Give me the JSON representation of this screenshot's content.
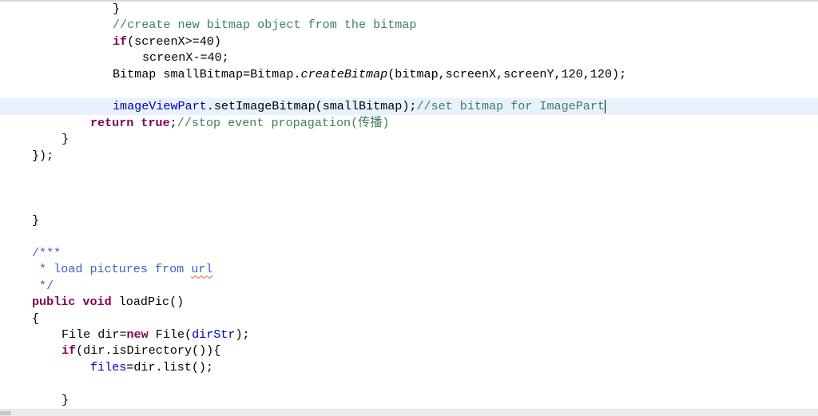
{
  "editor": {
    "current_line": 6,
    "lines": [
      [
        [
          "p",
          "}"
        ]
      ],
      [
        [
          "c",
          "//create new bitmap object from the bitmap"
        ]
      ],
      [
        [
          "k",
          "if"
        ],
        [
          "p",
          "(screenX>=40)"
        ]
      ],
      [
        [
          "p",
          "screenX-=40;"
        ]
      ],
      [
        [
          "p",
          "Bitmap smallBitmap=Bitmap."
        ],
        [
          "i",
          "createBitmap"
        ],
        [
          "p",
          "(bitmap,screenX,screenY,120,120);"
        ]
      ],
      [],
      [
        [
          "f",
          "imageViewPart"
        ],
        [
          "p",
          ".setImageBitmap(smallBitmap);"
        ],
        [
          "c",
          "//set bitmap for ImagePart"
        ]
      ],
      [
        [
          "k",
          "return"
        ],
        [
          "p",
          " "
        ],
        [
          "k",
          "true"
        ],
        [
          "p",
          ";"
        ],
        [
          "c",
          "//stop event propagation(传播)"
        ]
      ],
      [
        [
          "p",
          "}"
        ]
      ],
      [
        [
          "p",
          "});"
        ]
      ],
      [],
      [],
      [],
      [
        [
          "p",
          "}"
        ]
      ],
      [],
      [
        [
          "j",
          "/***"
        ]
      ],
      [
        [
          "j",
          " * load pictures from "
        ],
        [
          "u",
          "url"
        ]
      ],
      [
        [
          "j",
          " */"
        ]
      ],
      [
        [
          "k",
          "public"
        ],
        [
          "p",
          " "
        ],
        [
          "k",
          "void"
        ],
        [
          "p",
          " loadPic()"
        ]
      ],
      [
        [
          "p",
          "{"
        ]
      ],
      [
        [
          "p",
          "File dir="
        ],
        [
          "k",
          "new"
        ],
        [
          "p",
          " File("
        ],
        [
          "f",
          "dirStr"
        ],
        [
          "p",
          ");"
        ]
      ],
      [
        [
          "k",
          "if"
        ],
        [
          "p",
          "(dir.isDirectory()){"
        ]
      ],
      [
        [
          "f",
          "files"
        ],
        [
          "p",
          "=dir.list();"
        ]
      ],
      [],
      [
        [
          "p",
          "}"
        ]
      ]
    ]
  }
}
